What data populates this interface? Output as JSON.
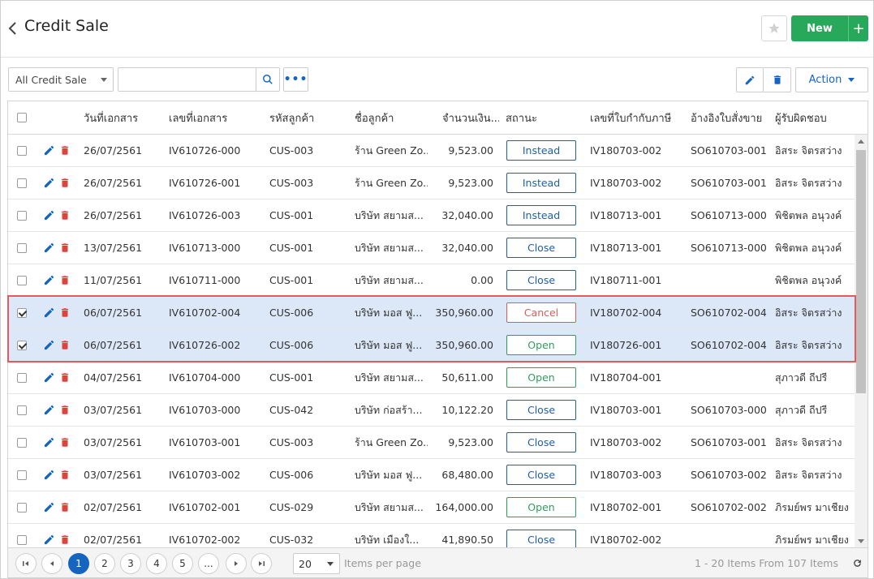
{
  "header": {
    "title": "Credit Sale",
    "new_label": "New",
    "plus_label": "+"
  },
  "toolbar": {
    "filter_value": "All Credit Sale",
    "search_placeholder": "",
    "more_label": "•••",
    "action_label": "Action"
  },
  "colors": {
    "primary": "#1565c0",
    "success": "#27a85a",
    "danger": "#e05a5a",
    "selected_row": "#dce8f8"
  },
  "grid": {
    "columns": [
      "วันที่เอกสาร",
      "เลขที่เอกสาร",
      "รหัสลูกค้า",
      "ชื่อลูกค้า",
      "จำนวนเงิน...",
      "สถานะ",
      "เลขที่ใบกำกับภาษี",
      "อ้างอิงใบสั่งขาย",
      "ผู้รับผิดชอบ"
    ],
    "rows": [
      {
        "checked": false,
        "date": "26/07/2561",
        "doc_no": "IV610726-000",
        "cust_code": "CUS-003",
        "cust_name": "ร้าน Green Zo...",
        "amount": "9,523.00",
        "status": "Instead",
        "status_style": "blue",
        "tax_no": "IV180703-002",
        "so_ref": "SO610703-001",
        "owner": "อิสระ จิตรสว่าง"
      },
      {
        "checked": false,
        "date": "26/07/2561",
        "doc_no": "IV610726-001",
        "cust_code": "CUS-003",
        "cust_name": "ร้าน Green Zo...",
        "amount": "9,523.00",
        "status": "Instead",
        "status_style": "blue",
        "tax_no": "IV180703-002",
        "so_ref": "SO610703-001",
        "owner": "อิสระ จิตรสว่าง"
      },
      {
        "checked": false,
        "date": "26/07/2561",
        "doc_no": "IV610726-003",
        "cust_code": "CUS-001",
        "cust_name": "บริษัท สยามส...",
        "amount": "32,040.00",
        "status": "Instead",
        "status_style": "blue",
        "tax_no": "IV180713-001",
        "so_ref": "SO610713-000",
        "owner": "พิชิตพล อนุวงค์"
      },
      {
        "checked": false,
        "date": "13/07/2561",
        "doc_no": "IV610713-000",
        "cust_code": "CUS-001",
        "cust_name": "บริษัท สยามส...",
        "amount": "32,040.00",
        "status": "Close",
        "status_style": "blue",
        "tax_no": "IV180713-001",
        "so_ref": "SO610713-000",
        "owner": "พิชิตพล อนุวงค์"
      },
      {
        "checked": false,
        "date": "11/07/2561",
        "doc_no": "IV610711-000",
        "cust_code": "CUS-001",
        "cust_name": "บริษัท สยามส...",
        "amount": "0.00",
        "status": "Close",
        "status_style": "blue",
        "tax_no": "IV180711-001",
        "so_ref": "",
        "owner": "พิชิตพล อนุวงค์"
      },
      {
        "checked": true,
        "date": "06/07/2561",
        "doc_no": "IV610702-004",
        "cust_code": "CUS-006",
        "cust_name": "บริษัท มอส ฟู...",
        "amount": "350,960.00",
        "status": "Cancel",
        "status_style": "red",
        "tax_no": "IV180702-004",
        "so_ref": "SO610702-004",
        "owner": "อิสระ จิตรสว่าง"
      },
      {
        "checked": true,
        "date": "06/07/2561",
        "doc_no": "IV610726-002",
        "cust_code": "CUS-006",
        "cust_name": "บริษัท มอส ฟู...",
        "amount": "350,960.00",
        "status": "Open",
        "status_style": "green",
        "tax_no": "IV180726-001",
        "so_ref": "SO610702-004",
        "owner": "อิสระ จิตรสว่าง"
      },
      {
        "checked": false,
        "date": "04/07/2561",
        "doc_no": "IV610704-000",
        "cust_code": "CUS-001",
        "cust_name": "บริษัท สยามส...",
        "amount": "50,611.00",
        "status": "Open",
        "status_style": "green",
        "tax_no": "IV180704-001",
        "so_ref": "",
        "owner": "สุภาวดี ถีปรี"
      },
      {
        "checked": false,
        "date": "03/07/2561",
        "doc_no": "IV610703-000",
        "cust_code": "CUS-042",
        "cust_name": "บริษัท ก่อสร้า...",
        "amount": "10,122.20",
        "status": "Close",
        "status_style": "blue",
        "tax_no": "IV180703-001",
        "so_ref": "SO610703-000",
        "owner": "สุภาวดี ถีปรี"
      },
      {
        "checked": false,
        "date": "03/07/2561",
        "doc_no": "IV610703-001",
        "cust_code": "CUS-003",
        "cust_name": "ร้าน Green Zo...",
        "amount": "9,523.00",
        "status": "Close",
        "status_style": "blue",
        "tax_no": "IV180703-002",
        "so_ref": "SO610703-001",
        "owner": "อิสระ จิตรสว่าง"
      },
      {
        "checked": false,
        "date": "03/07/2561",
        "doc_no": "IV610703-002",
        "cust_code": "CUS-006",
        "cust_name": "บริษัท มอส ฟู...",
        "amount": "68,480.00",
        "status": "Close",
        "status_style": "blue",
        "tax_no": "IV180703-003",
        "so_ref": "SO610703-002",
        "owner": "อิสระ จิตรสว่าง"
      },
      {
        "checked": false,
        "date": "02/07/2561",
        "doc_no": "IV610702-001",
        "cust_code": "CUS-029",
        "cust_name": "บริษัท สยามส...",
        "amount": "164,000.00",
        "status": "Open",
        "status_style": "green",
        "tax_no": "IV180702-001",
        "so_ref": "SO610702-002",
        "owner": "ภิรมย์พร มาเชียง"
      },
      {
        "checked": false,
        "date": "02/07/2561",
        "doc_no": "IV610702-002",
        "cust_code": "CUS-032",
        "cust_name": "บริษัท เมืองใ...",
        "amount": "41,890.50",
        "status": "Close",
        "status_style": "blue",
        "tax_no": "IV180702-002",
        "so_ref": "",
        "owner": "ภิรมย์พร มาเชียง"
      }
    ]
  },
  "pager": {
    "pages": [
      "1",
      "2",
      "3",
      "4",
      "5",
      "..."
    ],
    "current_page": "1",
    "per_page": "20",
    "per_page_label": "Items per page",
    "info": "1 - 20 Items From 107 Items"
  }
}
